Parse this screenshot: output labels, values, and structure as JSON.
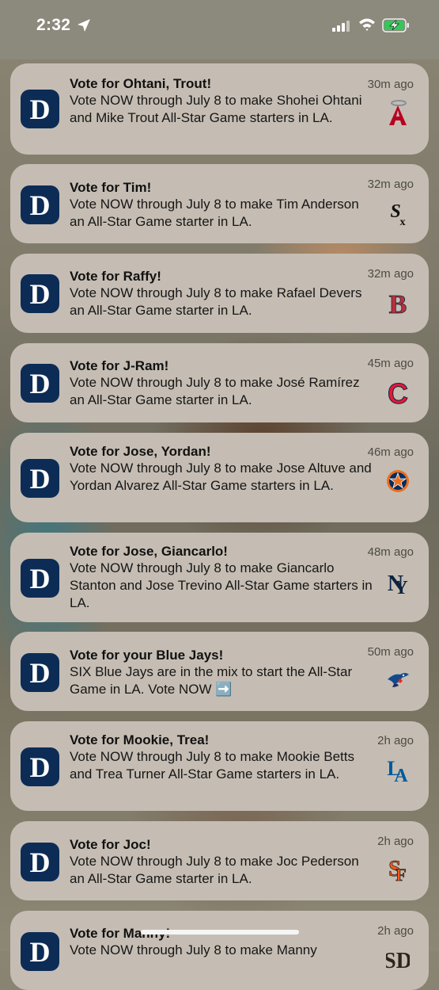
{
  "status_bar": {
    "time": "2:32",
    "icons": [
      "location-arrow-icon",
      "cellular-signal-icon",
      "wifi-icon",
      "battery-charging-icon"
    ]
  },
  "notifications": [
    {
      "title": "Vote for Ohtani, Trout!",
      "body": "Vote NOW through July 8 to make Shohei Ohtani and Mike Trout All-Star Game starters in LA.",
      "time": "30m ago",
      "team_icon": "angels-logo-icon"
    },
    {
      "title": "Vote for Tim!",
      "body": "Vote NOW through July 8 to make Tim Anderson an All-Star Game starter in LA.",
      "time": "32m ago",
      "team_icon": "white-sox-logo-icon"
    },
    {
      "title": "Vote for Raffy!",
      "body": "Vote NOW through July 8 to make Rafael Devers an All-Star Game starter in LA.",
      "time": "32m ago",
      "team_icon": "red-sox-logo-icon"
    },
    {
      "title": "Vote for J-Ram!",
      "body": "Vote NOW through July 8 to make José Ramírez an All-Star Game starter in LA.",
      "time": "45m ago",
      "team_icon": "guardians-logo-icon"
    },
    {
      "title": "Vote for Jose, Yordan!",
      "body": "Vote NOW through July 8 to make Jose Altuve and Yordan Alvarez All-Star Game starters in LA.",
      "time": "46m ago",
      "team_icon": "astros-logo-icon"
    },
    {
      "title": "Vote for Jose, Giancarlo!",
      "body": "Vote NOW through July 8 to make Giancarlo Stanton and Jose Trevino All-Star Game starters in LA.",
      "time": "48m ago",
      "team_icon": "yankees-logo-icon"
    },
    {
      "title": "Vote for your Blue Jays!",
      "body": "SIX Blue Jays are in the mix to start the All-Star Game in LA. Vote NOW ➡️",
      "time": "50m ago",
      "team_icon": "blue-jays-logo-icon"
    },
    {
      "title": "Vote for Mookie, Trea!",
      "body": "Vote NOW through July 8 to make Mookie Betts and Trea Turner All-Star Game starters in LA.",
      "time": "2h ago",
      "team_icon": "dodgers-logo-icon"
    },
    {
      "title": "Vote for Joc!",
      "body": "Vote NOW through July 8 to make Joc Pederson an All-Star Game starter in LA.",
      "time": "2h ago",
      "team_icon": "giants-logo-icon"
    },
    {
      "title": "Vote for Manny!",
      "body": "Vote NOW through July 8 to make Manny",
      "time": "2h ago",
      "team_icon": "padres-logo-icon"
    }
  ],
  "app_icon": "tigers-app-icon",
  "colors": {
    "card": "#c5bdb3",
    "app_icon_bg": "#0c2c56"
  }
}
